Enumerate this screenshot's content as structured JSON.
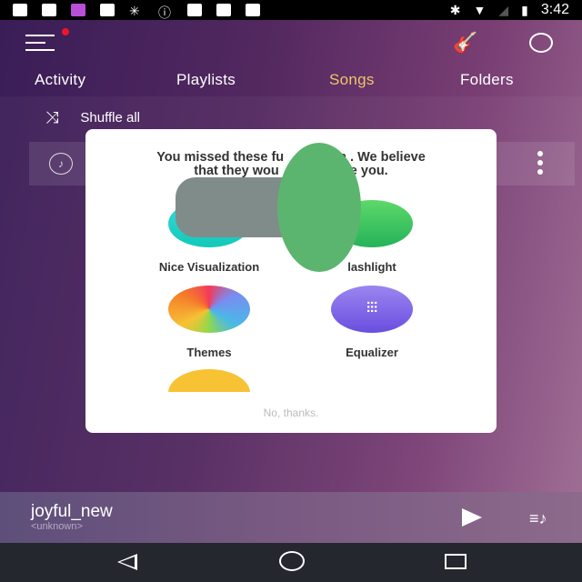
{
  "status_bar": {
    "time": "3:42",
    "icons": [
      "facebook-icon",
      "keyhole-icon",
      "music-app-icon",
      "mail-icon",
      "signal-icon",
      "info-icon",
      "satellite-icon",
      "lock-icon",
      "android-icon",
      "bluetooth-icon",
      "wifi-icon",
      "no-sim-icon",
      "battery-charging-icon"
    ]
  },
  "header": {
    "menu_badge_color": "#f0142a",
    "tabs": [
      {
        "label": "Activity"
      },
      {
        "label": "Playlists"
      },
      {
        "label": "Songs",
        "active": true
      },
      {
        "label": "Folders"
      }
    ],
    "accent": "#f1c46a"
  },
  "list": {
    "shuffle_label": "Shuffle all"
  },
  "dialog": {
    "message_line1_a": "You missed these fu",
    "message_line1_b": "n . We believe",
    "message_line2_a": "that they wou",
    "message_line2_b": "se you.",
    "features": [
      {
        "label": "Nice Visualization",
        "color": "#27cfcf"
      },
      {
        "label": "lashlight",
        "color": "#3cc25e"
      },
      {
        "label": "Themes",
        "color": "rainbow"
      },
      {
        "label": "Equalizer",
        "color": "#7d5ce8"
      },
      {
        "label": "",
        "color": "#f7c234"
      }
    ],
    "dismiss_label": "No, thanks."
  },
  "player": {
    "title": "joyful_new",
    "artist": "<unknown>"
  }
}
